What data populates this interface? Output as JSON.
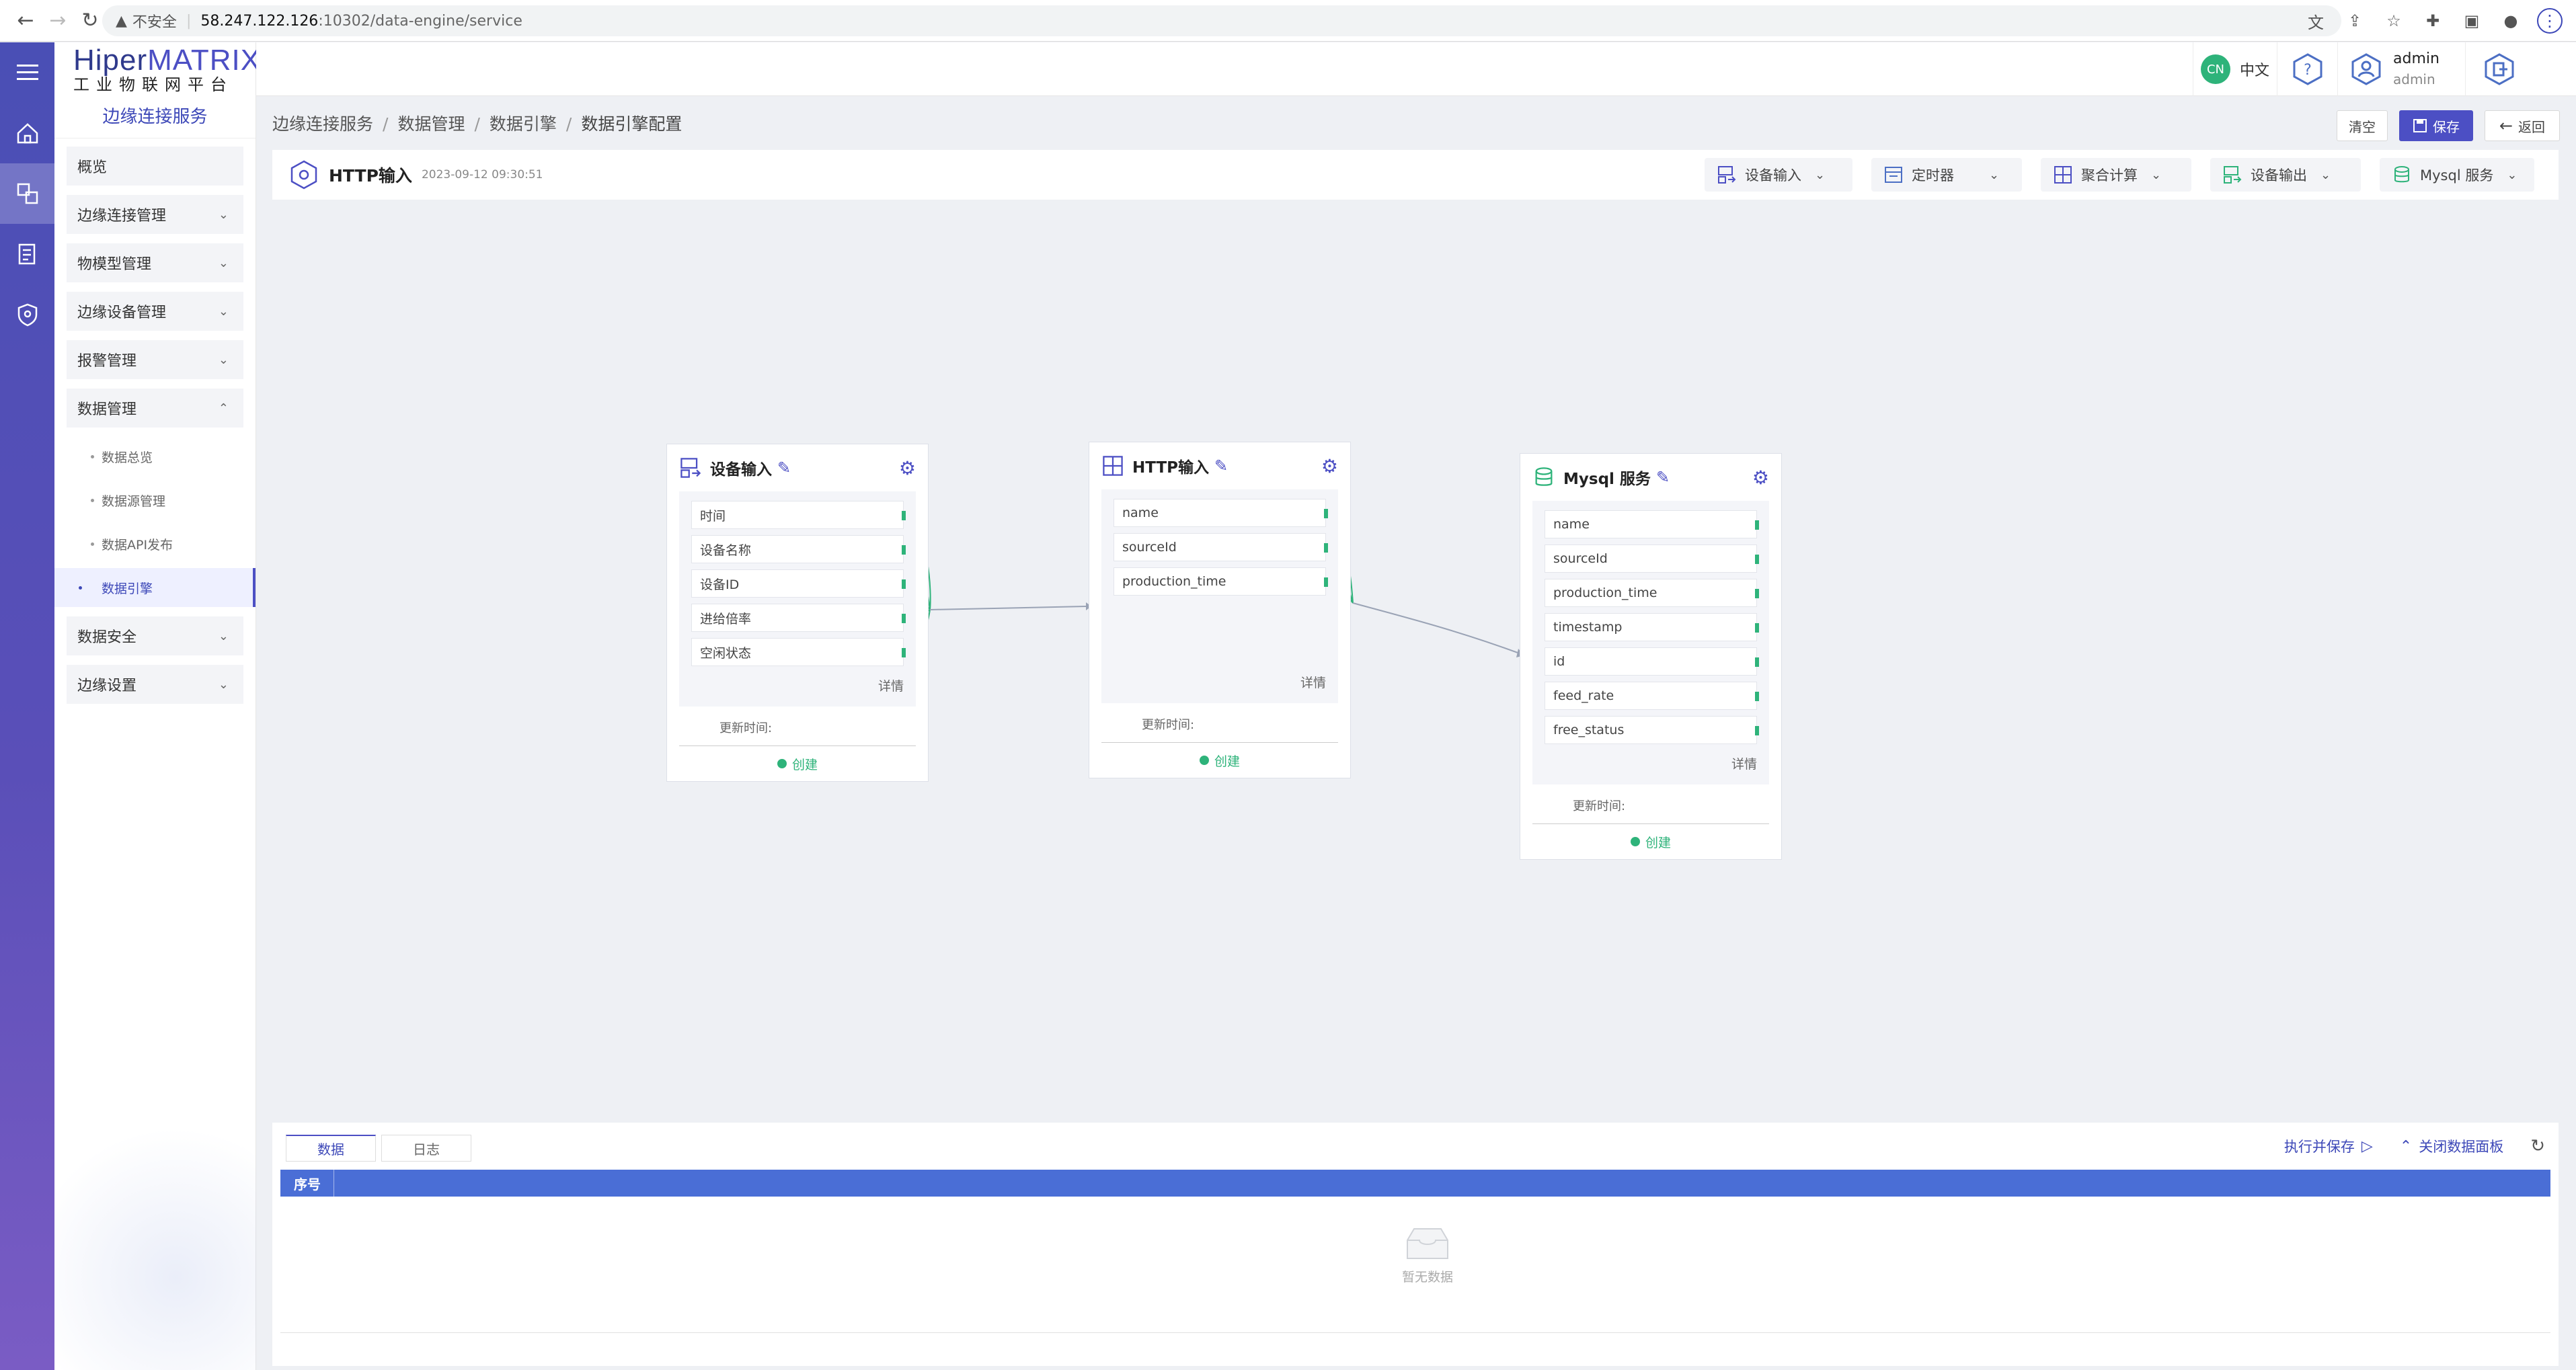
{
  "browser": {
    "insecure_label": "不安全",
    "url_host": "58.247.122.126",
    "url_path": ":10302/data-engine/service"
  },
  "brand": {
    "title_part1": "Hiper",
    "title_part2": "MATRIX",
    "subtitle": "工业物联网平台",
    "service": "边缘连接服务"
  },
  "sidebar": {
    "overview": "概览",
    "groups": [
      {
        "label": "边缘连接管理"
      },
      {
        "label": "物模型管理"
      },
      {
        "label": "边缘设备管理"
      },
      {
        "label": "报警管理"
      },
      {
        "label": "数据管理"
      }
    ],
    "data_sub": [
      {
        "label": "数据总览"
      },
      {
        "label": "数据源管理"
      },
      {
        "label": "数据API发布"
      },
      {
        "label": "数据引擎"
      }
    ],
    "after_groups": [
      {
        "label": "数据安全"
      },
      {
        "label": "边缘设置"
      }
    ]
  },
  "header": {
    "lang_badge": "CN",
    "lang_text": "中文",
    "user_name": "admin",
    "user_role": "admin"
  },
  "breadcrumb": [
    "边缘连接服务",
    "数据管理",
    "数据引擎",
    "数据引擎配置"
  ],
  "actions": {
    "clear": "清空",
    "save": "保存",
    "back": "返回"
  },
  "editor": {
    "title": "HTTP输入",
    "timestamp": "2023-09-12 09:30:51",
    "tools": [
      {
        "label": "设备输入",
        "icon": "device-input-icon"
      },
      {
        "label": "定时器",
        "icon": "timer-icon"
      },
      {
        "label": "聚合计算",
        "icon": "calc-icon"
      },
      {
        "label": "设备输出",
        "icon": "device-output-icon"
      },
      {
        "label": "Mysql 服务",
        "icon": "database-icon"
      }
    ]
  },
  "nodes": {
    "device_input": {
      "title": "设备输入",
      "fields": [
        "时间",
        "设备名称",
        "设备ID",
        "进给倍率",
        "空闲状态"
      ],
      "detail": "详情",
      "updated_label": "更新时间:",
      "status": "创建"
    },
    "http_input": {
      "title": "HTTP输入",
      "fields": [
        "name",
        "sourceId",
        "production_time"
      ],
      "detail": "详情",
      "updated_label": "更新时间:",
      "status": "创建"
    },
    "mysql": {
      "title": "Mysql 服务",
      "fields": [
        "name",
        "sourceId",
        "production_time",
        "timestamp",
        "id",
        "feed_rate",
        "free_status"
      ],
      "detail": "详情",
      "updated_label": "更新时间:",
      "status": "创建"
    }
  },
  "panel": {
    "tabs": [
      "数据",
      "日志"
    ],
    "run_save": "执行并保存",
    "close_panel": "关闭数据面板",
    "column": "序号",
    "empty": "暂无数据"
  },
  "colors": {
    "primary": "#4c4fc4",
    "success": "#2eb37a",
    "table_head": "#4a6ed6"
  }
}
